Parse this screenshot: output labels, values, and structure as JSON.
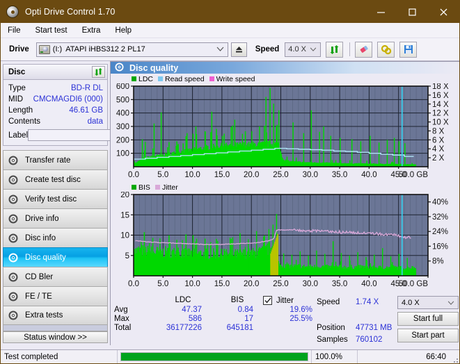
{
  "window": {
    "title": "Opti Drive Control 1.70",
    "icon": "disc-icon",
    "minimize": "minimize-icon",
    "maximize": "maximize-icon",
    "close": "close-icon",
    "titlebar_color": "#6b4a11"
  },
  "menu": {
    "items": [
      "File",
      "Start test",
      "Extra",
      "Help"
    ]
  },
  "toolbar": {
    "drive_label": "Drive",
    "drive_letter": "(I:)",
    "drive_value": "ATAPI iHBS312  2 PL17",
    "eject": "eject-icon",
    "speed_label": "Speed",
    "speed_value": "4.0 X",
    "refresh": "refresh-icon",
    "erase": "eraser-icon",
    "settings": "gear-icon",
    "save": "save-icon"
  },
  "disc": {
    "panel_title": "Disc",
    "refresh": "refresh-icon",
    "rows": [
      {
        "key": "Type",
        "value": "BD-R DL"
      },
      {
        "key": "MID",
        "value": "CMCMAGDI6 (000)"
      },
      {
        "key": "Length",
        "value": "46.61 GB"
      },
      {
        "key": "Contents",
        "value": "data"
      }
    ],
    "label_key": "Label",
    "label_value": "",
    "label_placeholder": "",
    "label_button": "disc-icon"
  },
  "sidebar": {
    "items": [
      {
        "label": "Transfer rate",
        "active": false
      },
      {
        "label": "Create test disc",
        "active": false
      },
      {
        "label": "Verify test disc",
        "active": false
      },
      {
        "label": "Drive info",
        "active": false
      },
      {
        "label": "Disc info",
        "active": false
      },
      {
        "label": "Disc quality",
        "active": true
      },
      {
        "label": "CD Bler",
        "active": false
      },
      {
        "label": "FE / TE",
        "active": false
      },
      {
        "label": "Extra tests",
        "active": false
      }
    ],
    "status_window": "Status window >>"
  },
  "main": {
    "header_title": "Disc quality",
    "header_icon": "disc-quality-icon"
  },
  "stats": {
    "col_ldc": "LDC",
    "col_bis": "BIS",
    "row_avg": "Avg",
    "row_max": "Max",
    "row_total": "Total",
    "ldc_avg": "47.37",
    "ldc_max": "586",
    "ldc_total": "36177226",
    "bis_avg": "0.84",
    "bis_max": "17",
    "bis_total": "645181",
    "jitter_label": "Jitter",
    "jitter_checked": true,
    "jitter_avg": "19.6%",
    "jitter_max": "25.5%"
  },
  "test_controls": {
    "speed_key": "Speed",
    "speed_value": "1.74 X",
    "position_key": "Position",
    "position_value": "47731 MB",
    "samples_key": "Samples",
    "samples_value": "760102",
    "speed_select": "4.0 X",
    "start_full": "Start full",
    "start_part": "Start part"
  },
  "statusbar": {
    "status": "Test completed",
    "percent": "100.0%",
    "progress": 100,
    "time": "66:40"
  },
  "chart_data": [
    {
      "type": "area",
      "title": "LDC / Read speed",
      "xlabel": "",
      "ylabel": "LDC",
      "xlim": [
        0,
        50
      ],
      "ylim": [
        0,
        600
      ],
      "y_ticks": [
        100,
        200,
        300,
        400,
        500,
        600
      ],
      "x_ticks": [
        0.0,
        5.0,
        10.0,
        15.0,
        20.0,
        25.0,
        30.0,
        35.0,
        40.0,
        45.0,
        50.0
      ],
      "x_tick_labels": [
        "0.0",
        "5.0",
        "10.0",
        "15.0",
        "20.0",
        "25.0",
        "30.0",
        "35.0",
        "40.0",
        "45.0",
        "50.0 GB"
      ],
      "y2_ticks": [
        2,
        4,
        6,
        8,
        10,
        12,
        14,
        16,
        18
      ],
      "y2_tick_labels": [
        "2 X",
        "4 X",
        "6 X",
        "8 X",
        "10 X",
        "12 X",
        "14 X",
        "16 X",
        "18 X"
      ],
      "y2_lim": [
        0,
        18
      ],
      "grid": true,
      "legend": [
        "LDC",
        "Read speed",
        "Write speed"
      ],
      "legend_colors": [
        "#00a800",
        "#7ec8ef",
        "#ee5fd0"
      ],
      "plot_bg": "#6b7696",
      "marker_x": 45.6,
      "series": [
        {
          "name": "LDC",
          "color": "#00d800",
          "kind": "bars",
          "x": [
            0.3,
            0.8,
            1.3,
            1.8,
            2.3,
            2.8,
            3.3,
            3.8,
            4.3,
            4.8,
            5.3,
            5.8,
            6.3,
            6.8,
            7.3,
            7.8,
            8.3,
            8.8,
            9.3,
            9.8,
            10.3,
            10.8,
            11.3,
            11.8,
            12.3,
            12.8,
            13.3,
            13.8,
            14.3,
            14.8,
            15.3,
            15.8,
            16.3,
            16.8,
            17.3,
            17.8,
            18.3,
            18.8,
            19.3,
            19.8,
            20.3,
            20.8,
            21.3,
            21.8,
            22.3,
            22.8,
            23.3,
            23.8,
            24.1,
            24.4,
            24.8,
            25.3,
            25.8,
            26.3,
            26.8,
            27.3,
            27.8,
            28.3,
            28.8,
            29.3,
            29.8,
            30.3,
            30.8,
            31.3,
            31.8,
            32.3,
            32.8,
            33.3,
            33.8,
            34.3,
            34.8,
            35.3,
            35.8,
            36.3,
            36.8,
            37.3,
            37.8,
            38.3,
            38.8,
            39.3,
            39.8,
            40.3,
            40.8,
            41.3,
            41.8,
            42.3,
            42.8,
            43.3,
            43.8,
            44.3,
            44.8,
            45.3,
            45.8,
            46.3,
            46.8,
            47.3,
            47.8
          ],
          "baseline": [
            28,
            40,
            55,
            62,
            66,
            70,
            74,
            78,
            80,
            84,
            88,
            92,
            95,
            99,
            103,
            107,
            110,
            112,
            116,
            120,
            124,
            128,
            130,
            134,
            138,
            140,
            142,
            145,
            147,
            148,
            150,
            151,
            152,
            153,
            154,
            155,
            156,
            157,
            158,
            158,
            159,
            160,
            160,
            161,
            161,
            162,
            162,
            163,
            163,
            163,
            120,
            55,
            45,
            40,
            38,
            36,
            35,
            34,
            33,
            32,
            31,
            30,
            30,
            29,
            29,
            28,
            28,
            27,
            27,
            26,
            26,
            25,
            25,
            25,
            24,
            24,
            24,
            23,
            23,
            23,
            22,
            22,
            22,
            21,
            21,
            21,
            20,
            20,
            20,
            19,
            19,
            19,
            18,
            18,
            18,
            17,
            17
          ],
          "spikes": [
            {
              "x": 1.4,
              "y": 205
            },
            {
              "x": 1.9,
              "y": 185
            },
            {
              "x": 3.4,
              "y": 322
            },
            {
              "x": 4.6,
              "y": 405
            },
            {
              "x": 9.0,
              "y": 250
            },
            {
              "x": 10.5,
              "y": 300
            },
            {
              "x": 12.1,
              "y": 260
            },
            {
              "x": 13.2,
              "y": 410
            },
            {
              "x": 15.0,
              "y": 230
            },
            {
              "x": 17.1,
              "y": 350
            },
            {
              "x": 18.4,
              "y": 245
            },
            {
              "x": 20.0,
              "y": 265
            },
            {
              "x": 21.3,
              "y": 300
            },
            {
              "x": 22.4,
              "y": 520
            },
            {
              "x": 23.1,
              "y": 586
            },
            {
              "x": 23.7,
              "y": 470
            },
            {
              "x": 24.6,
              "y": 420
            },
            {
              "x": 27.0,
              "y": 330
            },
            {
              "x": 28.8,
              "y": 250
            },
            {
              "x": 30.1,
              "y": 420
            },
            {
              "x": 31.5,
              "y": 260
            },
            {
              "x": 32.2,
              "y": 300
            },
            {
              "x": 33.4,
              "y": 230
            },
            {
              "x": 35.0,
              "y": 215
            },
            {
              "x": 37.0,
              "y": 205
            },
            {
              "x": 38.5,
              "y": 190
            },
            {
              "x": 40.1,
              "y": 230
            },
            {
              "x": 41.6,
              "y": 180
            },
            {
              "x": 43.0,
              "y": 200
            },
            {
              "x": 44.2,
              "y": 215
            },
            {
              "x": 45.0,
              "y": 190
            },
            {
              "x": 46.0,
              "y": 175
            }
          ]
        },
        {
          "name": "Read speed",
          "color": "#aee3f7",
          "kind": "step-line",
          "axis": "y2",
          "x": [
            0.0,
            2.0,
            4.0,
            6.0,
            8.0,
            10.0,
            12.0,
            14.0,
            16.0,
            18.0,
            20.0,
            22.0,
            24.0,
            26.0,
            28.0,
            30.0,
            32.0,
            34.0,
            36.0,
            38.0,
            40.0,
            42.0,
            44.0,
            46.0,
            47.5
          ],
          "y": [
            1.7,
            1.9,
            2.1,
            2.3,
            2.5,
            2.7,
            2.9,
            3.1,
            3.3,
            3.5,
            3.7,
            3.9,
            4.1,
            4.0,
            3.9,
            3.8,
            3.7,
            3.5,
            3.4,
            3.2,
            3.0,
            2.8,
            2.6,
            2.3,
            2.2
          ]
        }
      ]
    },
    {
      "type": "area",
      "title": "BIS / Jitter",
      "xlabel": "",
      "ylabel": "BIS",
      "xlim": [
        0,
        50
      ],
      "ylim": [
        0,
        20
      ],
      "y_ticks": [
        5,
        10,
        15,
        20
      ],
      "x_ticks": [
        0.0,
        5.0,
        10.0,
        15.0,
        20.0,
        25.0,
        30.0,
        35.0,
        40.0,
        45.0,
        50.0
      ],
      "x_tick_labels": [
        "0.0",
        "5.0",
        "10.0",
        "15.0",
        "20.0",
        "25.0",
        "30.0",
        "35.0",
        "40.0",
        "45.0",
        "50.0 GB"
      ],
      "y2_ticks": [
        8,
        16,
        24,
        32,
        40
      ],
      "y2_tick_labels": [
        "8%",
        "16%",
        "24%",
        "32%",
        "40%"
      ],
      "y2_lim": [
        0,
        44
      ],
      "grid": true,
      "legend": [
        "BIS",
        "Jitter"
      ],
      "legend_colors": [
        "#00a800",
        "#d9a8d9"
      ],
      "plot_bg": "#6b7696",
      "marker_x": 45.6,
      "series": [
        {
          "name": "BIS",
          "color": "#00d800",
          "kind": "bars",
          "baseline_x": [
            0.3,
            1.0,
            2.0,
            3.0,
            4.0,
            5.0,
            6.0,
            7.0,
            8.0,
            9.0,
            10.0,
            11.0,
            12.0,
            13.0,
            14.0,
            15.0,
            16.0,
            17.0,
            18.0,
            19.0,
            20.0,
            21.0,
            22.0,
            23.0,
            23.8,
            24.3,
            25.0,
            26.0,
            27.0,
            28.0,
            29.0,
            30.0,
            31.0,
            32.0,
            33.0,
            34.0,
            35.0,
            36.0,
            37.0,
            38.0,
            39.0,
            40.0,
            41.0,
            42.0,
            43.0,
            44.0,
            45.0,
            46.0,
            47.0,
            47.8
          ],
          "baseline_y": [
            5.6,
            5.8,
            5.6,
            5.5,
            5.4,
            5.4,
            5.3,
            5.3,
            5.2,
            5.2,
            5.1,
            5.1,
            5.0,
            5.0,
            5.0,
            4.9,
            4.9,
            4.9,
            5.0,
            5.0,
            5.1,
            5.3,
            5.6,
            6.2,
            7.2,
            3.2,
            2.3,
            2.2,
            2.2,
            2.2,
            2.1,
            2.1,
            2.1,
            2.1,
            2.0,
            2.0,
            2.0,
            2.0,
            2.0,
            2.0,
            2.0,
            2.0,
            1.9,
            1.9,
            1.9,
            1.9,
            1.8,
            1.8,
            1.8,
            1.8
          ],
          "spikes": [
            {
              "x": 1.2,
              "y": 8.5
            },
            {
              "x": 2.6,
              "y": 8.0
            },
            {
              "x": 4.4,
              "y": 9.2
            },
            {
              "x": 6.1,
              "y": 8.3
            },
            {
              "x": 8.2,
              "y": 8.8
            },
            {
              "x": 10.4,
              "y": 8.4
            },
            {
              "x": 12.5,
              "y": 8.0
            },
            {
              "x": 14.2,
              "y": 8.6
            },
            {
              "x": 16.3,
              "y": 9.4
            },
            {
              "x": 18.0,
              "y": 10.5
            },
            {
              "x": 19.4,
              "y": 9.0
            },
            {
              "x": 20.8,
              "y": 11.0
            },
            {
              "x": 22.0,
              "y": 9.6
            },
            {
              "x": 22.9,
              "y": 11.5
            },
            {
              "x": 23.6,
              "y": 12.6
            },
            {
              "x": 24.2,
              "y": 15.2
            },
            {
              "x": 25.4,
              "y": 5.5
            },
            {
              "x": 26.8,
              "y": 5.2
            },
            {
              "x": 28.2,
              "y": 6.0
            },
            {
              "x": 29.6,
              "y": 5.0
            },
            {
              "x": 31.0,
              "y": 6.2
            },
            {
              "x": 32.4,
              "y": 5.4
            },
            {
              "x": 33.8,
              "y": 8.5
            },
            {
              "x": 35.2,
              "y": 5.6
            },
            {
              "x": 36.6,
              "y": 5.0
            },
            {
              "x": 38.0,
              "y": 5.8
            },
            {
              "x": 39.4,
              "y": 4.6
            },
            {
              "x": 40.8,
              "y": 5.2
            },
            {
              "x": 42.2,
              "y": 6.8
            },
            {
              "x": 43.6,
              "y": 4.8
            },
            {
              "x": 45.0,
              "y": 5.4
            },
            {
              "x": 46.4,
              "y": 4.4
            }
          ]
        },
        {
          "name": "Jitter",
          "color": "#d9a8d9",
          "kind": "line",
          "axis": "y2",
          "x": [
            0.3,
            1.5,
            3.0,
            4.5,
            6.0,
            7.5,
            9.0,
            10.5,
            12.0,
            13.5,
            15.0,
            16.5,
            18.0,
            19.5,
            21.0,
            22.0,
            23.0,
            23.8,
            24.3,
            26.0,
            28.0,
            30.0,
            32.0,
            34.0,
            36.0,
            38.0,
            40.0,
            42.0,
            44.0,
            45.4,
            46.2,
            47.2
          ],
          "y": [
            19.0,
            18.6,
            18.2,
            18.0,
            17.8,
            17.6,
            17.4,
            17.2,
            17.0,
            17.0,
            17.0,
            17.2,
            17.4,
            17.6,
            18.0,
            18.4,
            19.0,
            20.0,
            24.8,
            24.8,
            24.8,
            24.3,
            24.0,
            23.8,
            23.6,
            23.4,
            23.0,
            22.6,
            22.2,
            21.2,
            20.4,
            21.0
          ]
        }
      ]
    }
  ]
}
